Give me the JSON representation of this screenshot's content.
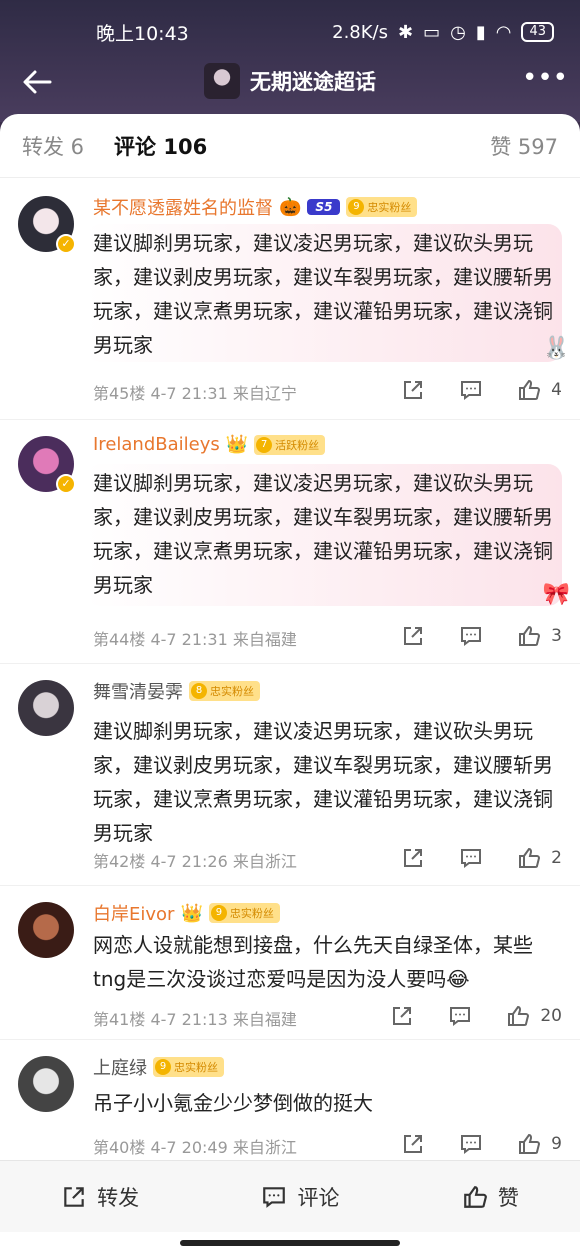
{
  "status_bar": {
    "time": "晚上10:43",
    "net_speed": "2.8K/s",
    "battery": "43",
    "icons": [
      "bluetooth-icon",
      "vibrate-icon",
      "alarm-icon",
      "hd-signal-icon",
      "wifi-icon",
      "battery-icon"
    ]
  },
  "nav": {
    "topic_title": "无期迷途超话",
    "back_icon": "back-arrow-icon",
    "more_label": "•••"
  },
  "tabs": {
    "repost": "转发 6",
    "comments": "评论 106",
    "likes": "赞 597"
  },
  "comments": [
    {
      "user": "某不愿透露姓名的监督",
      "badge_s5": "S5",
      "fan_level": "9",
      "fan_label": "忠实粉丝",
      "text": "建议脚刹男玩家，建议凌迟男玩家，建议砍头男玩家，建议剥皮男玩家，建议车裂男玩家，建议腰斩男玩家，建议烹煮男玩家，建议灌铅男玩家，建议浇铜男玩家",
      "meta": "第45楼 4-7 21:31 来自辽宁",
      "likes": "4"
    },
    {
      "user": "IrelandBaileys",
      "fan_level": "7",
      "fan_label": "活跃粉丝",
      "text": "建议脚刹男玩家，建议凌迟男玩家，建议砍头男玩家，建议剥皮男玩家，建议车裂男玩家，建议腰斩男玩家，建议烹煮男玩家，建议灌铅男玩家，建议浇铜男玩家",
      "meta": "第44楼 4-7 21:31 来自福建",
      "likes": "3"
    },
    {
      "user": "舞雪清晏霁",
      "fan_level": "8",
      "fan_label": "忠实粉丝",
      "text": "建议脚刹男玩家，建议凌迟男玩家，建议砍头男玩家，建议剥皮男玩家，建议车裂男玩家，建议腰斩男玩家，建议烹煮男玩家，建议灌铅男玩家，建议浇铜男玩家",
      "meta": "第42楼 4-7 21:26 来自浙江",
      "likes": "2"
    },
    {
      "user": "白岸Eivor",
      "fan_level": "9",
      "fan_label": "忠实粉丝",
      "text": "网恋人设就能想到接盘，什么先天自绿圣体，某些tng是三次没谈过恋爱吗是因为没人要吗😂",
      "meta": "第41楼 4-7 21:13 来自福建",
      "likes": "20"
    },
    {
      "user": "上庭绿",
      "fan_level": "9",
      "fan_label": "忠实粉丝",
      "text": "吊子小小氪金少少梦倒做的挺大",
      "meta": "第40楼 4-7 20:49 来自浙江",
      "likes": "9"
    }
  ],
  "bottom_bar": {
    "repost": "转发",
    "comment": "评论",
    "like": "赞"
  },
  "colors": {
    "accent_orange": "#e8772e",
    "fan_badge": "#ffe08a",
    "header_bg": "#2f2b45"
  }
}
